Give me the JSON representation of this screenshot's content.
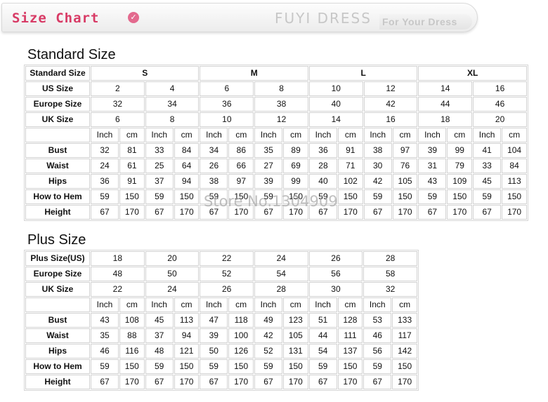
{
  "header": {
    "title": "Size Chart",
    "icon": "chevron-down-icon",
    "brand": "FUYI DRESS",
    "tagline": "For Your Dress"
  },
  "standard": {
    "title": "Standard Size",
    "header_label": "Standard Size",
    "groups": [
      "S",
      "M",
      "L",
      "XL"
    ],
    "us_label": "US Size",
    "us": [
      "2",
      "4",
      "6",
      "8",
      "10",
      "12",
      "14",
      "16"
    ],
    "europe_label": "Europe Size",
    "europe": [
      "32",
      "34",
      "36",
      "38",
      "40",
      "42",
      "44",
      "46"
    ],
    "uk_label": "UK Size",
    "uk": [
      "6",
      "8",
      "10",
      "12",
      "14",
      "16",
      "18",
      "20"
    ],
    "unit_inch": "Inch",
    "unit_cm": "cm",
    "measures": [
      {
        "label": "Bust",
        "values": [
          "32",
          "81",
          "33",
          "84",
          "34",
          "86",
          "35",
          "89",
          "36",
          "91",
          "38",
          "97",
          "39",
          "99",
          "41",
          "104"
        ]
      },
      {
        "label": "Waist",
        "values": [
          "24",
          "61",
          "25",
          "64",
          "26",
          "66",
          "27",
          "69",
          "28",
          "71",
          "30",
          "76",
          "31",
          "79",
          "33",
          "84"
        ]
      },
      {
        "label": "Hips",
        "values": [
          "36",
          "91",
          "37",
          "94",
          "38",
          "97",
          "39",
          "99",
          "40",
          "102",
          "42",
          "105",
          "43",
          "109",
          "45",
          "113"
        ]
      },
      {
        "label": "How to Hem",
        "values": [
          "59",
          "150",
          "59",
          "150",
          "59",
          "150",
          "59",
          "150",
          "59",
          "150",
          "59",
          "150",
          "59",
          "150",
          "59",
          "150"
        ]
      },
      {
        "label": "Height",
        "values": [
          "67",
          "170",
          "67",
          "170",
          "67",
          "170",
          "67",
          "170",
          "67",
          "170",
          "67",
          "170",
          "67",
          "170",
          "67",
          "170"
        ]
      }
    ]
  },
  "plus": {
    "title": "Plus Size",
    "us_label": "Plus Size(US)",
    "us": [
      "18",
      "20",
      "22",
      "24",
      "26",
      "28"
    ],
    "europe_label": "Europe Size",
    "europe": [
      "48",
      "50",
      "52",
      "54",
      "56",
      "58"
    ],
    "uk_label": "UK Size",
    "uk": [
      "22",
      "24",
      "26",
      "28",
      "30",
      "32"
    ],
    "unit_inch": "Inch",
    "unit_cm": "cm",
    "measures": [
      {
        "label": "Bust",
        "values": [
          "43",
          "108",
          "45",
          "113",
          "47",
          "118",
          "49",
          "123",
          "51",
          "128",
          "53",
          "133"
        ]
      },
      {
        "label": "Waist",
        "values": [
          "35",
          "88",
          "37",
          "94",
          "39",
          "100",
          "42",
          "105",
          "44",
          "111",
          "46",
          "117"
        ]
      },
      {
        "label": "Hips",
        "values": [
          "46",
          "116",
          "48",
          "121",
          "50",
          "126",
          "52",
          "131",
          "54",
          "137",
          "56",
          "142"
        ]
      },
      {
        "label": "How to Hem",
        "values": [
          "59",
          "150",
          "59",
          "150",
          "59",
          "150",
          "59",
          "150",
          "59",
          "150",
          "59",
          "150"
        ]
      },
      {
        "label": "Height",
        "values": [
          "67",
          "170",
          "67",
          "170",
          "67",
          "170",
          "67",
          "170",
          "67",
          "170",
          "67",
          "170"
        ]
      }
    ]
  },
  "watermark": "Store No.1304909"
}
